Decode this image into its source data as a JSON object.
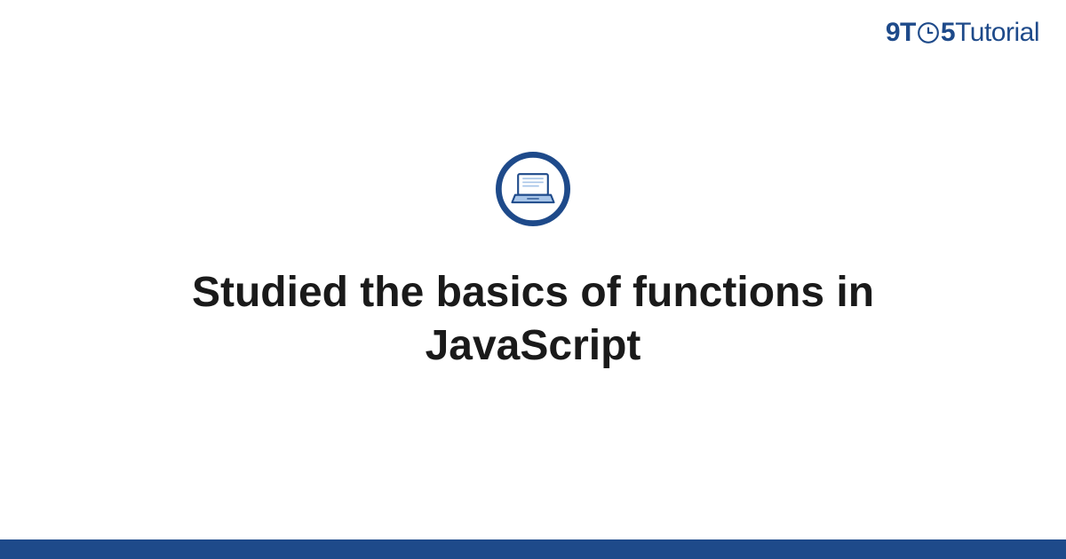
{
  "brand": {
    "prefix": "9T",
    "mid": "5",
    "suffix": "Tutorial"
  },
  "title": "Studied the basics of functions in JavaScript",
  "colors": {
    "brand": "#1e4a8a",
    "iconRing": "#1e4a8a",
    "iconLight": "#a8c5e8"
  },
  "icons": {
    "center": "laptop-icon",
    "logo": "clock-icon"
  }
}
